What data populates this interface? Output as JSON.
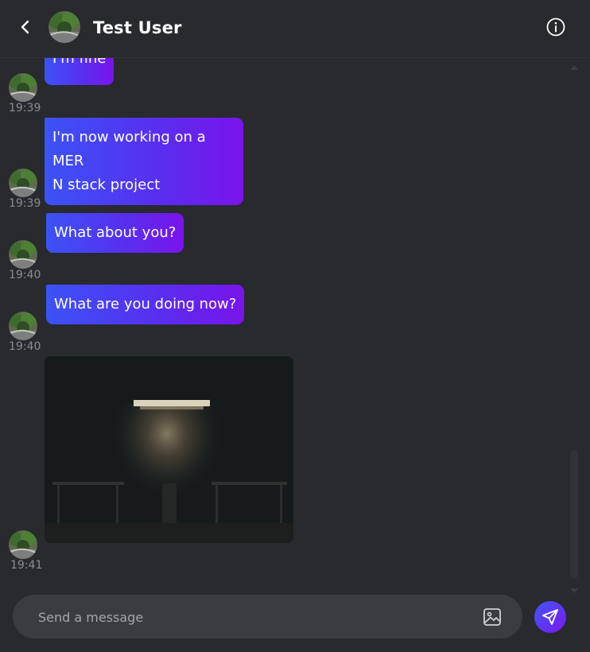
{
  "header": {
    "title": "Test User",
    "back_icon": "chevron-left-icon",
    "info_icon": "info-circle-icon"
  },
  "messages": [
    {
      "text": "I'm fine",
      "time": "19:39"
    },
    {
      "lines": [
        "I'm now working on a MER",
        "N stack project"
      ],
      "time": "19:39"
    },
    {
      "text": "What about you?",
      "time": "19:40"
    },
    {
      "text": "What are you doing now?",
      "time": "19:40"
    },
    {
      "type": "image",
      "time": "19:41"
    }
  ],
  "composer": {
    "placeholder": "Send a message",
    "image_icon": "image-icon",
    "send_icon": "send-icon"
  },
  "colors": {
    "background": "#282a2e",
    "bubble_start": "#3b53f5",
    "bubble_end": "#7a14ec",
    "input_bg": "#3a3c41",
    "muted_text": "#8a8d93"
  }
}
